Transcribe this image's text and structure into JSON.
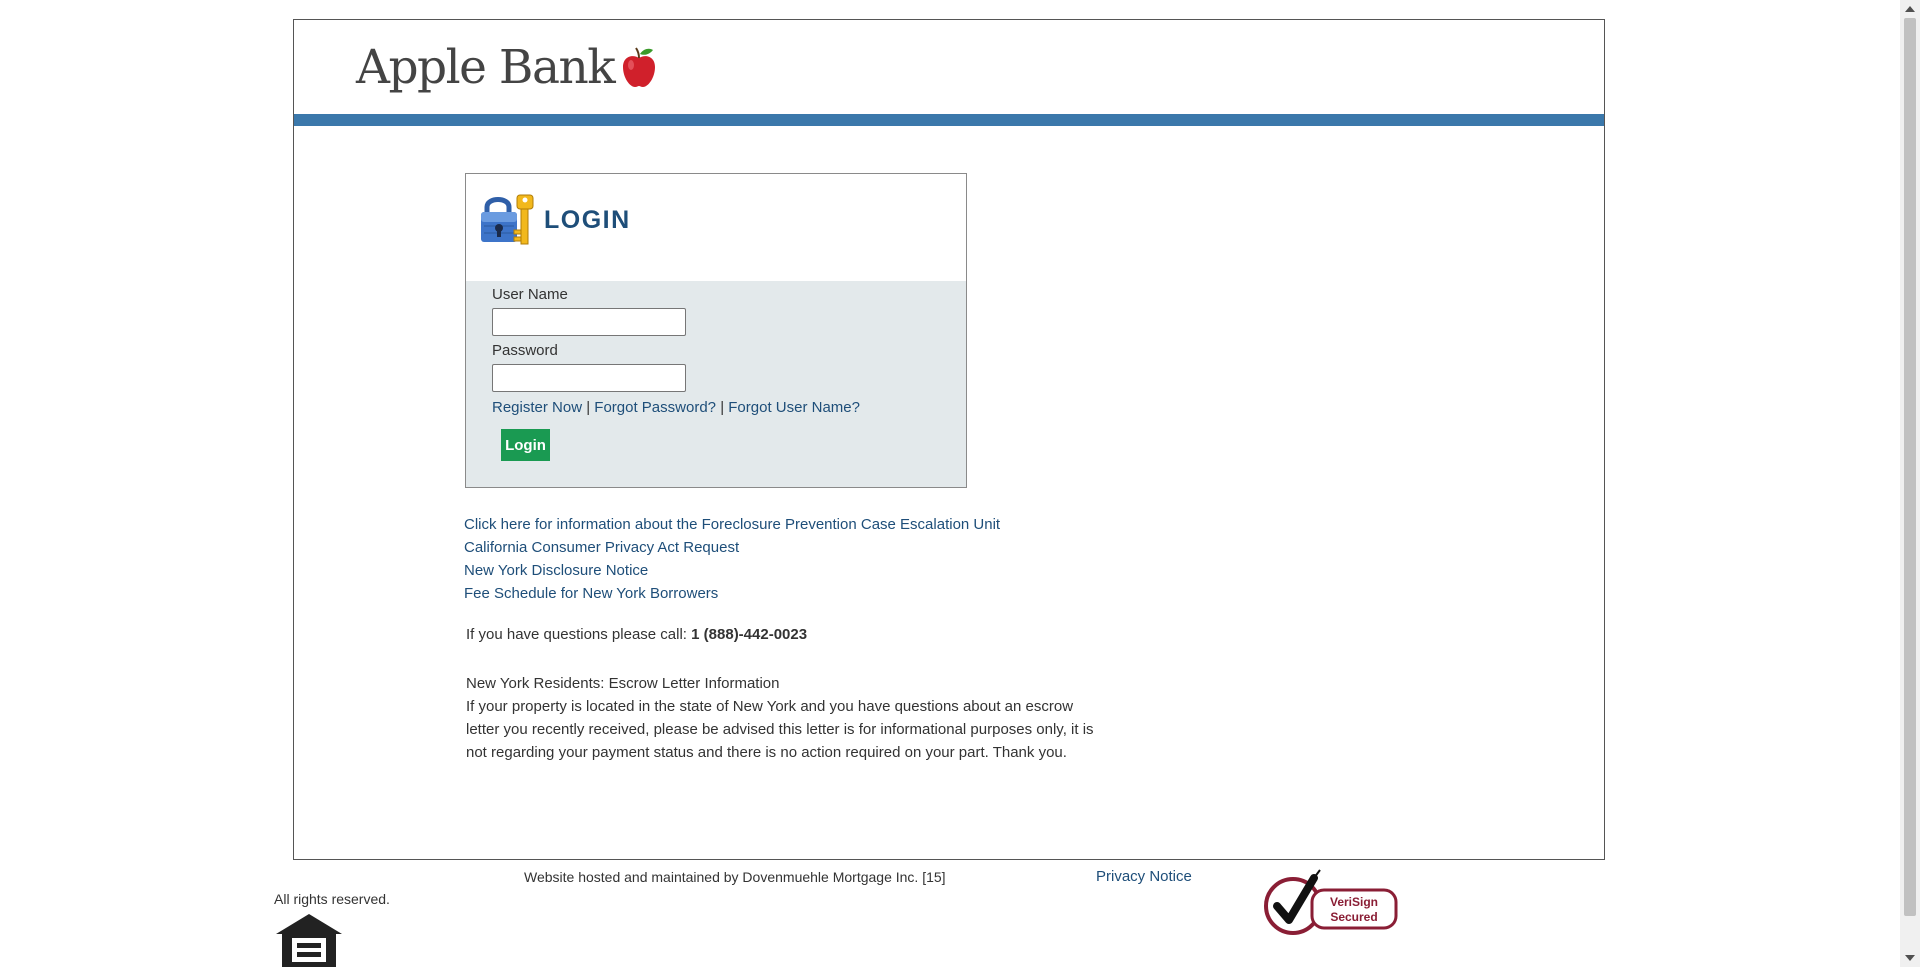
{
  "brand": {
    "name": "Apple Bank"
  },
  "login": {
    "title": "LOGIN",
    "username_label": "User Name",
    "username_value": "",
    "password_label": "Password",
    "password_value": "",
    "register_link": "Register Now",
    "separator": "|",
    "forgot_password_link": "Forgot Password?",
    "forgot_username_link": "Forgot User Name?",
    "login_button": "Login"
  },
  "info_links": [
    "Click here for information about the Foreclosure Prevention Case Escalation Unit",
    "California Consumer Privacy Act Request",
    "New York Disclosure Notice",
    "Fee Schedule for New York Borrowers"
  ],
  "contact": {
    "prefix": "If you have questions please call:",
    "phone": "1 (888)-442-0023"
  },
  "escrow": {
    "heading": "New York Residents: Escrow Letter Information",
    "body": "If your property is located in the state of New York and you have questions about an escrow letter you recently received, please be advised this letter is for informational purposes only, it is not regarding your payment status and there is no action required on your part. Thank you."
  },
  "footer": {
    "hosted": "Website hosted and maintained by Dovenmuehle Mortgage Inc. [15]",
    "privacy": "Privacy Notice",
    "rights": "All rights reserved.",
    "verisign_line1": "VeriSign",
    "verisign_line2": "Secured"
  },
  "colors": {
    "header_bar": "#3b78ab",
    "link": "#1e4e79",
    "login_button": "#1a9a52",
    "form_bg": "#e3e9eb"
  },
  "icons": [
    "apple-logo-icon",
    "padlock-key-icon",
    "equal-housing-icon",
    "verisign-check-icon"
  ]
}
